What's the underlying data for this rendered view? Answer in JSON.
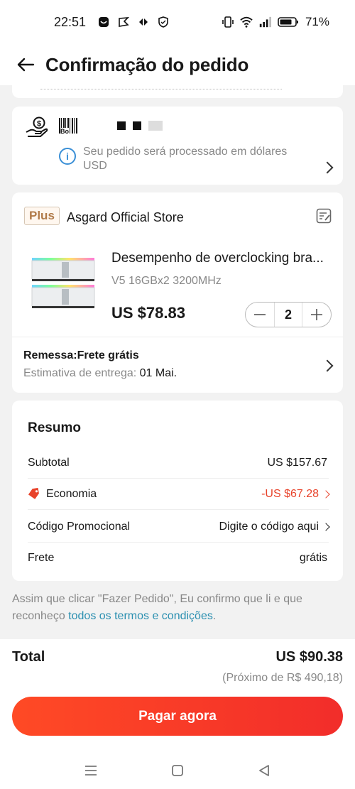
{
  "status_bar": {
    "time": "22:51",
    "battery": "71%"
  },
  "header": {
    "title": "Confirmação do pedido"
  },
  "payment": {
    "masked_card": "Bo",
    "info": "Seu pedido será processado em dólares USD"
  },
  "order": {
    "badge": "Plus",
    "store": "Asgard Official Store",
    "product_title": "Desempenho de overclocking bra...",
    "variant": "V5 16GBx2 3200MHz",
    "price": "US $78.83",
    "quantity": "2",
    "shipping_title": "Remessa:Frete grátis",
    "estimate_label": "Estimativa de entrega: ",
    "estimate_date": "01 Mai."
  },
  "summary": {
    "title": "Resumo",
    "rows": [
      {
        "label": "Subtotal",
        "value": "US $157.67"
      },
      {
        "label": "Economia",
        "value": "-US $67.28"
      },
      {
        "label": "Código Promocional",
        "value": "Digite o código aqui"
      },
      {
        "label": "Frete",
        "value": "grátis"
      }
    ]
  },
  "consent": {
    "text": "Assim que clicar \"Fazer Pedido\", Eu confirmo que li e que reconheço ",
    "link": "todos os termos e condições",
    "end": "."
  },
  "footer": {
    "total_label": "Total",
    "total_value": "US $90.38",
    "approx": "(Próximo de R$ 490,18)",
    "pay_button": "Pagar agora"
  },
  "colors": {
    "accent": "#f22d2a",
    "link": "#2a8fb0",
    "discount": "#e8432b",
    "info": "#3a8fd6"
  },
  "icons": [
    "back-arrow-icon",
    "payment-hand-icon",
    "info-icon",
    "chevron-right-icon",
    "note-edit-icon",
    "minus-icon",
    "plus-icon",
    "tag-icon",
    "menu-icon",
    "home-icon",
    "back-icon"
  ]
}
